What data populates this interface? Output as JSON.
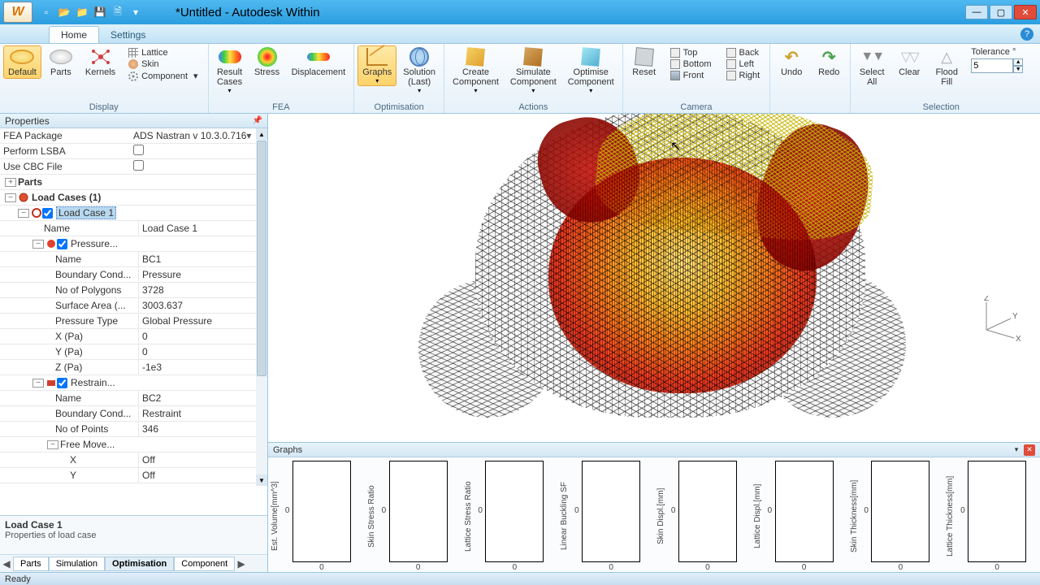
{
  "window": {
    "title": "*Untitled - Autodesk Within",
    "app_glyph": "W"
  },
  "tabs": {
    "home": "Home",
    "settings": "Settings"
  },
  "ribbon": {
    "display": {
      "label": "Display",
      "default": "Default",
      "parts": "Parts",
      "kernels": "Kernels",
      "lattice": "Lattice",
      "skin": "Skin",
      "component": "Component"
    },
    "fea": {
      "label": "FEA",
      "result_cases": "Result\nCases",
      "stress": "Stress",
      "displacement": "Displacement"
    },
    "optimisation": {
      "label": "Optimisation",
      "graphs": "Graphs",
      "solution": "Solution\n(Last)"
    },
    "actions": {
      "label": "Actions",
      "create": "Create\nComponent",
      "simulate": "Simulate\nComponent",
      "optimise": "Optimise\nComponent"
    },
    "camera": {
      "label": "Camera",
      "reset": "Reset",
      "top": "Top",
      "bottom": "Bottom",
      "front": "Front",
      "back": "Back",
      "left": "Left",
      "right": "Right"
    },
    "undo": "Undo",
    "redo": "Redo",
    "selection": {
      "label": "Selection",
      "select_all": "Select\nAll",
      "clear": "Clear",
      "flood_fill": "Flood\nFill",
      "tolerance_label": "Tolerance °",
      "tolerance_value": "5"
    }
  },
  "properties": {
    "title": "Properties",
    "fea_package": {
      "k": "FEA Package",
      "v": "ADS Nastran v 10.3.0.716"
    },
    "perform_lsba": {
      "k": "Perform LSBA"
    },
    "use_cbc": {
      "k": "Use CBC File"
    },
    "parts_label": "Parts",
    "load_cases_label": "Load Cases (1)",
    "load_case_1": "Load Case 1",
    "lc_name_k": "Name",
    "lc_name_v": "Load Case 1",
    "pressure_label": "Pressure...",
    "bc1": {
      "name_k": "Name",
      "name_v": "BC1",
      "bcond_k": "Boundary Cond...",
      "bcond_v": "Pressure",
      "npoly_k": "No of Polygons",
      "npoly_v": "3728",
      "sarea_k": "Surface Area (...",
      "sarea_v": "3003.637",
      "ptype_k": "Pressure Type",
      "ptype_v": "Global Pressure",
      "x_k": "X (Pa)",
      "x_v": "0",
      "y_k": "Y (Pa)",
      "y_v": "0",
      "z_k": "Z (Pa)",
      "z_v": "-1e3"
    },
    "restrain_label": "Restrain...",
    "bc2": {
      "name_k": "Name",
      "name_v": "BC2",
      "bcond_k": "Boundary Cond...",
      "bcond_v": "Restraint",
      "npts_k": "No of Points",
      "npts_v": "346",
      "freemove_k": "Free Move...",
      "x_k": "X",
      "x_v": "Off",
      "y_k": "Y",
      "y_v": "Off"
    },
    "desc_title": "Load Case 1",
    "desc_body": "Properties of load case",
    "inner_tabs": {
      "parts": "Parts",
      "simulation": "Simulation",
      "optimisation": "Optimisation",
      "component": "Component"
    }
  },
  "graphs_panel": {
    "title": "Graphs",
    "items": [
      {
        "ylabel": "Est. Volume[mm^3]",
        "ytick": "0",
        "xval": "0"
      },
      {
        "ylabel": "Skin Stress Ratio",
        "ytick": "0",
        "xval": "0"
      },
      {
        "ylabel": "Lattice Stress Ratio",
        "ytick": "0",
        "xval": "0"
      },
      {
        "ylabel": "Linear Buckling SF",
        "ytick": "0",
        "xval": "0"
      },
      {
        "ylabel": "Skin Displ.[mm]",
        "ytick": "0",
        "xval": "0"
      },
      {
        "ylabel": "Lattice Displ.[mm]",
        "ytick": "0",
        "xval": "0"
      },
      {
        "ylabel": "Skin Thickness[mm]",
        "ytick": "0",
        "xval": "0"
      },
      {
        "ylabel": "Lattice Thickness[mm]",
        "ytick": "0",
        "xval": "0"
      }
    ]
  },
  "axis": {
    "x": "X",
    "y": "Y",
    "z": "Z"
  },
  "status": "Ready"
}
